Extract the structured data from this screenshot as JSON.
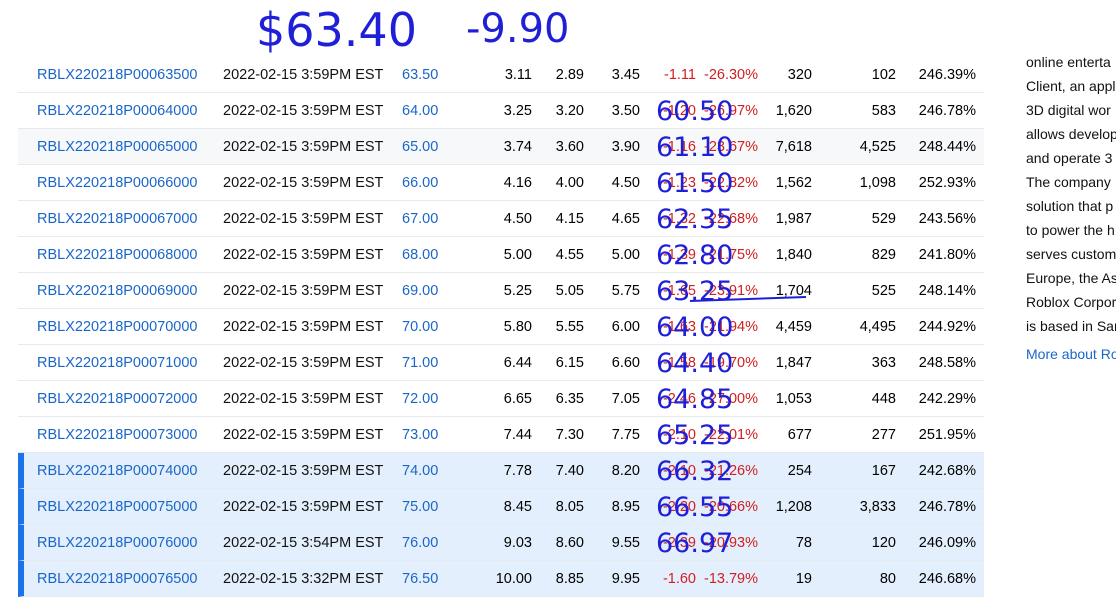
{
  "annotations": {
    "price": "$63.40",
    "change": "-9.90",
    "row_notes": [
      "60.50",
      "61.10",
      "61.50",
      "62.35",
      "62.80",
      "63.25",
      "64.00",
      "64.40",
      "64.85",
      "65.25",
      "66.32",
      "66.55",
      "66.97"
    ]
  },
  "options_table": {
    "rows": [
      {
        "symbol": "RBLX220218P00063500",
        "date": "2022-02-15 3:59PM EST",
        "strike": "63.50",
        "last": "3.11",
        "bid": "2.89",
        "ask": "3.45",
        "change": "-1.11",
        "pct_change": "-26.30%",
        "volume": "320",
        "open_interest": "102",
        "iv": "246.39%",
        "style": "plain"
      },
      {
        "symbol": "RBLX220218P00064000",
        "date": "2022-02-15 3:59PM EST",
        "strike": "64.00",
        "last": "3.25",
        "bid": "3.20",
        "ask": "3.50",
        "change": "-1.20",
        "pct_change": "-26.97%",
        "volume": "1,620",
        "open_interest": "583",
        "iv": "246.78%",
        "style": "plain"
      },
      {
        "symbol": "RBLX220218P00065000",
        "date": "2022-02-15 3:59PM EST",
        "strike": "65.00",
        "last": "3.74",
        "bid": "3.60",
        "ask": "3.90",
        "change": "-1.16",
        "pct_change": "-23.67%",
        "volume": "7,618",
        "open_interest": "4,525",
        "iv": "248.44%",
        "style": "alt"
      },
      {
        "symbol": "RBLX220218P00066000",
        "date": "2022-02-15 3:59PM EST",
        "strike": "66.00",
        "last": "4.16",
        "bid": "4.00",
        "ask": "4.50",
        "change": "-1.23",
        "pct_change": "-22.82%",
        "volume": "1,562",
        "open_interest": "1,098",
        "iv": "252.93%",
        "style": "plain"
      },
      {
        "symbol": "RBLX220218P00067000",
        "date": "2022-02-15 3:59PM EST",
        "strike": "67.00",
        "last": "4.50",
        "bid": "4.15",
        "ask": "4.65",
        "change": "-1.32",
        "pct_change": "-22.68%",
        "volume": "1,987",
        "open_interest": "529",
        "iv": "243.56%",
        "style": "plain"
      },
      {
        "symbol": "RBLX220218P00068000",
        "date": "2022-02-15 3:59PM EST",
        "strike": "68.00",
        "last": "5.00",
        "bid": "4.55",
        "ask": "5.00",
        "change": "-1.39",
        "pct_change": "-21.75%",
        "volume": "1,840",
        "open_interest": "829",
        "iv": "241.80%",
        "style": "plain"
      },
      {
        "symbol": "RBLX220218P00069000",
        "date": "2022-02-15 3:59PM EST",
        "strike": "69.00",
        "last": "5.25",
        "bid": "5.05",
        "ask": "5.75",
        "change": "-1.65",
        "pct_change": "-23.91%",
        "volume": "1,704",
        "open_interest": "525",
        "iv": "248.14%",
        "style": "plain"
      },
      {
        "symbol": "RBLX220218P00070000",
        "date": "2022-02-15 3:59PM EST",
        "strike": "70.00",
        "last": "5.80",
        "bid": "5.55",
        "ask": "6.00",
        "change": "-1.63",
        "pct_change": "-21.94%",
        "volume": "4,459",
        "open_interest": "4,495",
        "iv": "244.92%",
        "style": "plain"
      },
      {
        "symbol": "RBLX220218P00071000",
        "date": "2022-02-15 3:59PM EST",
        "strike": "71.00",
        "last": "6.44",
        "bid": "6.15",
        "ask": "6.60",
        "change": "-1.58",
        "pct_change": "-19.70%",
        "volume": "1,847",
        "open_interest": "363",
        "iv": "248.58%",
        "style": "plain"
      },
      {
        "symbol": "RBLX220218P00072000",
        "date": "2022-02-15 3:59PM EST",
        "strike": "72.00",
        "last": "6.65",
        "bid": "6.35",
        "ask": "7.05",
        "change": "-2.46",
        "pct_change": "-27.00%",
        "volume": "1,053",
        "open_interest": "448",
        "iv": "242.29%",
        "style": "plain"
      },
      {
        "symbol": "RBLX220218P00073000",
        "date": "2022-02-15 3:59PM EST",
        "strike": "73.00",
        "last": "7.44",
        "bid": "7.30",
        "ask": "7.75",
        "change": "-2.10",
        "pct_change": "-22.01%",
        "volume": "677",
        "open_interest": "277",
        "iv": "251.95%",
        "style": "plain"
      },
      {
        "symbol": "RBLX220218P00074000",
        "date": "2022-02-15 3:59PM EST",
        "strike": "74.00",
        "last": "7.78",
        "bid": "7.40",
        "ask": "8.20",
        "change": "-2.10",
        "pct_change": "-21.26%",
        "volume": "254",
        "open_interest": "167",
        "iv": "242.68%",
        "style": "itm"
      },
      {
        "symbol": "RBLX220218P00075000",
        "date": "2022-02-15 3:59PM EST",
        "strike": "75.00",
        "last": "8.45",
        "bid": "8.05",
        "ask": "8.95",
        "change": "-2.20",
        "pct_change": "-20.66%",
        "volume": "1,208",
        "open_interest": "3,833",
        "iv": "246.78%",
        "style": "itm"
      },
      {
        "symbol": "RBLX220218P00076000",
        "date": "2022-02-15 3:54PM EST",
        "strike": "76.00",
        "last": "9.03",
        "bid": "8.60",
        "ask": "9.55",
        "change": "-2.39",
        "pct_change": "-20.93%",
        "volume": "78",
        "open_interest": "120",
        "iv": "246.09%",
        "style": "itm"
      },
      {
        "symbol": "RBLX220218P00076500",
        "date": "2022-02-15 3:32PM EST",
        "strike": "76.50",
        "last": "10.00",
        "bid": "8.85",
        "ask": "9.95",
        "change": "-1.60",
        "pct_change": "-13.79%",
        "volume": "19",
        "open_interest": "80",
        "iv": "246.68%",
        "style": "itm"
      }
    ]
  },
  "sidebar": {
    "lines": [
      "online enterta",
      "Client, an appl",
      "3D digital wor",
      "allows develop",
      "and operate 3",
      "The company",
      "solution that p",
      "to power the h",
      "serves custom",
      "Europe, the As",
      "Roblox Corpor",
      "is based in San"
    ],
    "more_link": "More about Ro"
  },
  "colors": {
    "link": "#1a66c8",
    "negative": "#d21e1e",
    "itm_background": "#e3effc",
    "itm_marker": "#1a73e8",
    "ink": "#1f1fd8"
  }
}
